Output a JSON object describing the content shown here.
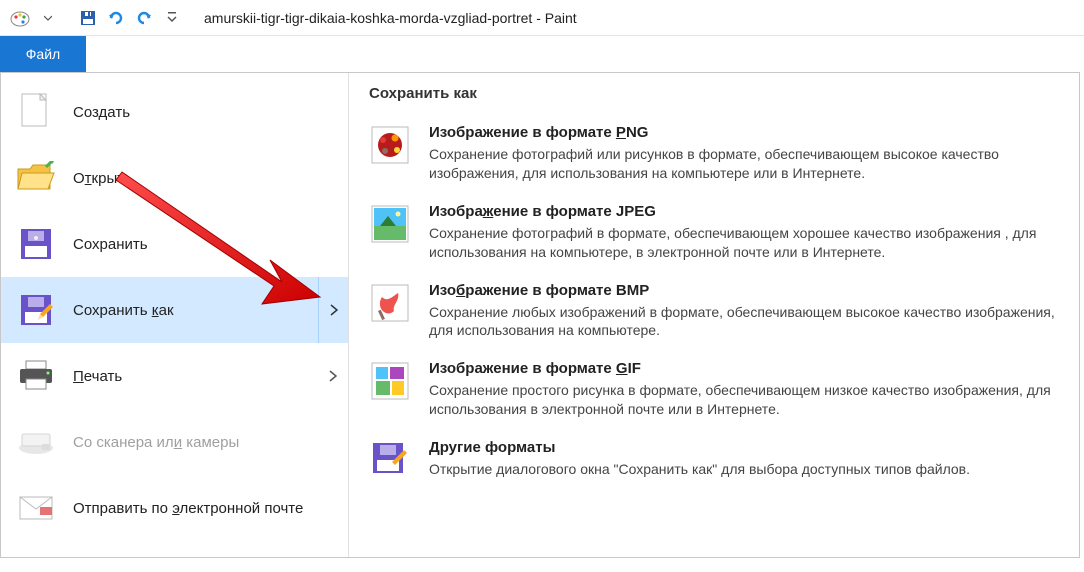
{
  "titlebar": {
    "title": "amurskii-tigr-tigr-dikaia-koshka-morda-vzgliad-portret - Paint"
  },
  "tab": {
    "file": "Файл"
  },
  "menu": {
    "new": "Создать",
    "open_pre": "О",
    "open_u": "т",
    "open_post": "крыть",
    "save": "Сохранить",
    "saveas_pre": "Сохранить ",
    "saveas_u": "к",
    "saveas_post": "ак",
    "print_u": "П",
    "print_post": "ечать",
    "scanner_pre": "Со сканера ил",
    "scanner_u": "и",
    "scanner_post": " камеры",
    "email_pre": "Отправить по ",
    "email_u": "э",
    "email_post": "лектронной почте"
  },
  "sub": {
    "heading": "Сохранить как",
    "png": {
      "title_pre": "Изображение в формате ",
      "title_u": "P",
      "title_post": "NG",
      "desc": "Сохранение фотографий или рисунков в формате, обеспечивающем высокое качество изображения, для использования на компьютере или в Интернете."
    },
    "jpeg": {
      "title_pre": "Изобра",
      "title_u": "ж",
      "title_post": "ение в формате JPEG",
      "desc": "Сохранение фотографий в формате, обеспечивающем хорошее качество изображения , для использования на компьютере, в электронной почте или в Интернете."
    },
    "bmp": {
      "title_pre": "Изо",
      "title_u": "б",
      "title_post": "ражение в формате BMP",
      "desc": "Сохранение любых изображений в формате, обеспечивающем высокое качество изображения, для использования на компьютере."
    },
    "gif": {
      "title_pre": "Изображение в формате ",
      "title_u": "G",
      "title_post": "IF",
      "desc": "Сохранение простого рисунка в формате, обеспечивающем низкое качество изображения, для использования в электронной почте или в Интернете."
    },
    "other": {
      "title_pre": "",
      "title_u": "Д",
      "title_post": "ругие форматы",
      "desc": "Открытие диалогового окна \"Сохранить как\" для выбора доступных типов файлов."
    }
  }
}
